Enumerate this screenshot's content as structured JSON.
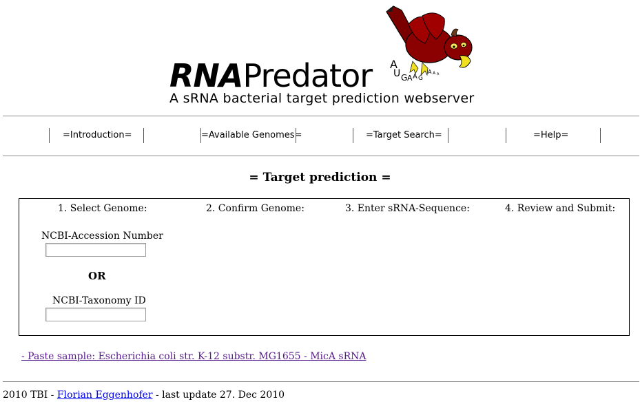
{
  "header": {
    "logo_bold": "RNA",
    "logo_rest": "Predator",
    "subtitle": "A sRNA bacterial target prediction webserver",
    "sequence_letters": [
      "A",
      "U",
      "G",
      "A",
      "A",
      "G",
      "A",
      "A",
      "A"
    ]
  },
  "nav": {
    "items": [
      {
        "label": "=Introduction="
      },
      {
        "label": "=Available Genomes="
      },
      {
        "label": "=Target Search="
      },
      {
        "label": "=Help="
      }
    ]
  },
  "main": {
    "title": "= Target prediction =",
    "steps": [
      {
        "label": "1. Select Genome:"
      },
      {
        "label": "2. Confirm Genome:"
      },
      {
        "label": "3. Enter sRNA-Sequence:"
      },
      {
        "label": "4. Review and Submit:"
      }
    ],
    "accession_label": "NCBI-Accession Number",
    "accession_value": "",
    "or_label": "OR",
    "taxonomy_label": "NCBI-Taxonomy ID",
    "taxonomy_value": ""
  },
  "sample_link": "- Paste sample: Escherichia coli str. K-12 substr. MG1655 - MicA sRNA",
  "footer": {
    "prefix": "2010 TBI - ",
    "author": "Florian Eggenhofer",
    "suffix": " - last update 27. Dec 2010"
  },
  "colors": {
    "bird_body": "#8b0000",
    "bird_beak": "#f0e020",
    "visited_link": "#551a8b",
    "link": "#0000ee"
  }
}
